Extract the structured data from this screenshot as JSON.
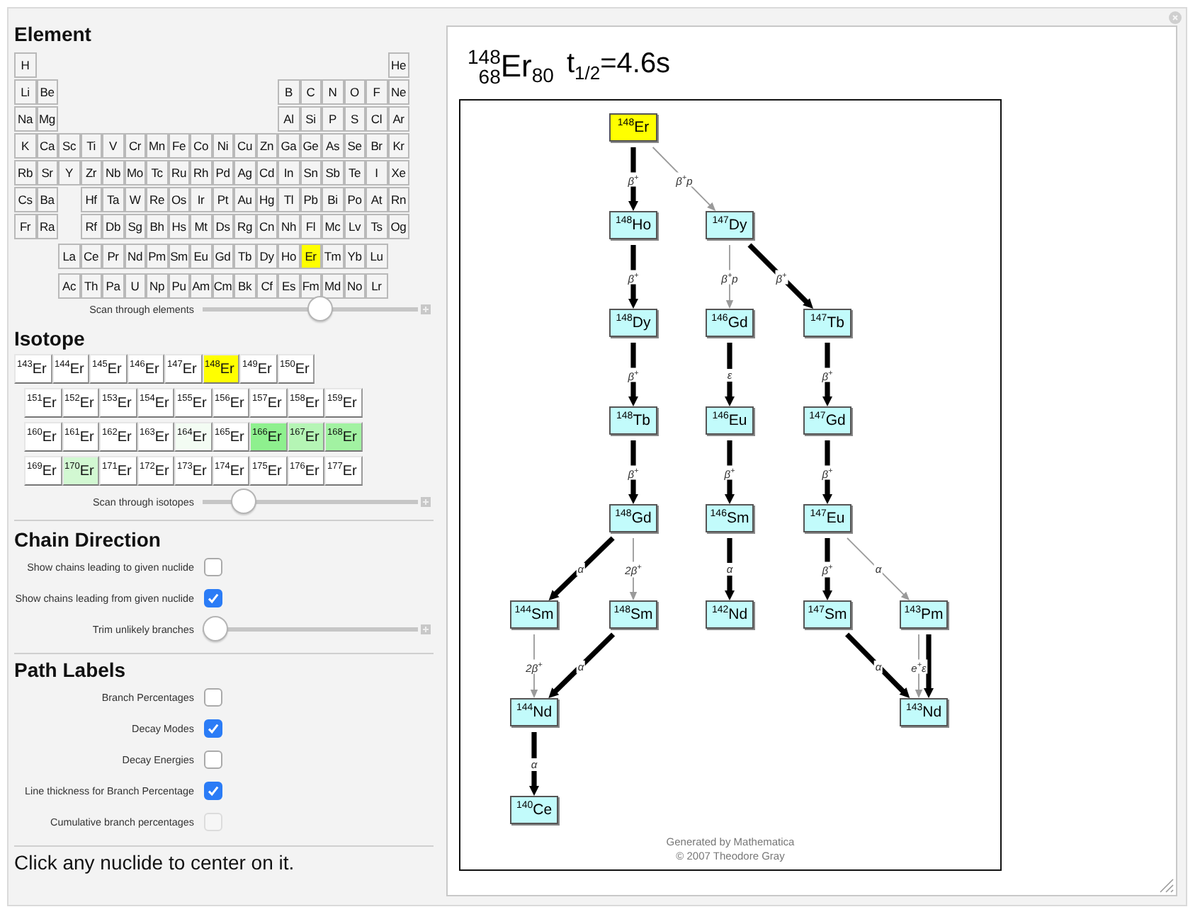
{
  "panel": {
    "element_section": {
      "heading": "Element",
      "table": [
        [
          [
            {
              "symbol": "H",
              "selected": false
            }
          ],
          [
            {
              "symbol": "He",
              "selected": false
            }
          ]
        ],
        [
          [
            {
              "symbol": "Li",
              "selected": false
            },
            {
              "symbol": "Be",
              "selected": false
            }
          ],
          [
            {
              "symbol": "B",
              "selected": false
            },
            {
              "symbol": "C",
              "selected": false
            },
            {
              "symbol": "N",
              "selected": false
            },
            {
              "symbol": "O",
              "selected": false
            },
            {
              "symbol": "F",
              "selected": false
            },
            {
              "symbol": "Ne",
              "selected": false
            }
          ]
        ],
        [
          [
            {
              "symbol": "Na",
              "selected": false
            },
            {
              "symbol": "Mg",
              "selected": false
            }
          ],
          [
            {
              "symbol": "Al",
              "selected": false
            },
            {
              "symbol": "Si",
              "selected": false
            },
            {
              "symbol": "P",
              "selected": false
            },
            {
              "symbol": "S",
              "selected": false
            },
            {
              "symbol": "Cl",
              "selected": false
            },
            {
              "symbol": "Ar",
              "selected": false
            }
          ]
        ],
        [
          [
            {
              "symbol": "K",
              "selected": false
            },
            {
              "symbol": "Ca",
              "selected": false
            },
            {
              "symbol": "Sc",
              "selected": false
            },
            {
              "symbol": "Ti",
              "selected": false
            },
            {
              "symbol": "V",
              "selected": false
            },
            {
              "symbol": "Cr",
              "selected": false
            },
            {
              "symbol": "Mn",
              "selected": false
            },
            {
              "symbol": "Fe",
              "selected": false
            },
            {
              "symbol": "Co",
              "selected": false
            },
            {
              "symbol": "Ni",
              "selected": false
            },
            {
              "symbol": "Cu",
              "selected": false
            },
            {
              "symbol": "Zn",
              "selected": false
            },
            {
              "symbol": "Ga",
              "selected": false
            },
            {
              "symbol": "Ge",
              "selected": false
            },
            {
              "symbol": "As",
              "selected": false
            },
            {
              "symbol": "Se",
              "selected": false
            },
            {
              "symbol": "Br",
              "selected": false
            },
            {
              "symbol": "Kr",
              "selected": false
            }
          ]
        ],
        [
          [
            {
              "symbol": "Rb",
              "selected": false
            },
            {
              "symbol": "Sr",
              "selected": false
            },
            {
              "symbol": "Y",
              "selected": false
            },
            {
              "symbol": "Zr",
              "selected": false
            },
            {
              "symbol": "Nb",
              "selected": false
            },
            {
              "symbol": "Mo",
              "selected": false
            },
            {
              "symbol": "Tc",
              "selected": false
            },
            {
              "symbol": "Ru",
              "selected": false
            },
            {
              "symbol": "Rh",
              "selected": false
            },
            {
              "symbol": "Pd",
              "selected": false
            },
            {
              "symbol": "Ag",
              "selected": false
            },
            {
              "symbol": "Cd",
              "selected": false
            },
            {
              "symbol": "In",
              "selected": false
            },
            {
              "symbol": "Sn",
              "selected": false
            },
            {
              "symbol": "Sb",
              "selected": false
            },
            {
              "symbol": "Te",
              "selected": false
            },
            {
              "symbol": "I",
              "selected": false
            },
            {
              "symbol": "Xe",
              "selected": false
            }
          ]
        ],
        [
          [
            {
              "symbol": "Cs",
              "selected": false
            },
            {
              "symbol": "Ba",
              "selected": false
            }
          ],
          [
            {
              "symbol": "Hf",
              "selected": false
            },
            {
              "symbol": "Ta",
              "selected": false
            },
            {
              "symbol": "W",
              "selected": false
            },
            {
              "symbol": "Re",
              "selected": false
            },
            {
              "symbol": "Os",
              "selected": false
            },
            {
              "symbol": "Ir",
              "selected": false
            },
            {
              "symbol": "Pt",
              "selected": false
            },
            {
              "symbol": "Au",
              "selected": false
            },
            {
              "symbol": "Hg",
              "selected": false
            },
            {
              "symbol": "Tl",
              "selected": false
            },
            {
              "symbol": "Pb",
              "selected": false
            },
            {
              "symbol": "Bi",
              "selected": false
            },
            {
              "symbol": "Po",
              "selected": false
            },
            {
              "symbol": "At",
              "selected": false
            },
            {
              "symbol": "Rn",
              "selected": false
            }
          ]
        ],
        [
          [
            {
              "symbol": "Fr",
              "selected": false
            },
            {
              "symbol": "Ra",
              "selected": false
            }
          ],
          [
            {
              "symbol": "Rf",
              "selected": false
            },
            {
              "symbol": "Db",
              "selected": false
            },
            {
              "symbol": "Sg",
              "selected": false
            },
            {
              "symbol": "Bh",
              "selected": false
            },
            {
              "symbol": "Hs",
              "selected": false
            },
            {
              "symbol": "Mt",
              "selected": false
            },
            {
              "symbol": "Ds",
              "selected": false
            },
            {
              "symbol": "Rg",
              "selected": false
            },
            {
              "symbol": "Cn",
              "selected": false
            },
            {
              "symbol": "Nh",
              "selected": false
            },
            {
              "symbol": "Fl",
              "selected": false
            },
            {
              "symbol": "Mc",
              "selected": false
            },
            {
              "symbol": "Lv",
              "selected": false
            },
            {
              "symbol": "Ts",
              "selected": false
            },
            {
              "symbol": "Og",
              "selected": false
            }
          ]
        ],
        [
          [
            {
              "symbol": "La",
              "selected": false
            },
            {
              "symbol": "Ce",
              "selected": false
            },
            {
              "symbol": "Pr",
              "selected": false
            },
            {
              "symbol": "Nd",
              "selected": false
            },
            {
              "symbol": "Pm",
              "selected": false
            },
            {
              "symbol": "Sm",
              "selected": false
            },
            {
              "symbol": "Eu",
              "selected": false
            },
            {
              "symbol": "Gd",
              "selected": false
            },
            {
              "symbol": "Tb",
              "selected": false
            },
            {
              "symbol": "Dy",
              "selected": false
            },
            {
              "symbol": "Ho",
              "selected": false
            },
            {
              "symbol": "Er",
              "selected": true
            },
            {
              "symbol": "Tm",
              "selected": false
            },
            {
              "symbol": "Yb",
              "selected": false
            },
            {
              "symbol": "Lu",
              "selected": false
            }
          ]
        ],
        [
          [
            {
              "symbol": "Ac",
              "selected": false
            },
            {
              "symbol": "Th",
              "selected": false
            },
            {
              "symbol": "Pa",
              "selected": false
            },
            {
              "symbol": "U",
              "selected": false
            },
            {
              "symbol": "Np",
              "selected": false
            },
            {
              "symbol": "Pu",
              "selected": false
            },
            {
              "symbol": "Am",
              "selected": false
            },
            {
              "symbol": "Cm",
              "selected": false
            },
            {
              "symbol": "Bk",
              "selected": false
            },
            {
              "symbol": "Cf",
              "selected": false
            },
            {
              "symbol": "Es",
              "selected": false
            },
            {
              "symbol": "Fm",
              "selected": false
            },
            {
              "symbol": "Md",
              "selected": false
            },
            {
              "symbol": "No",
              "selected": false
            },
            {
              "symbol": "Lr",
              "selected": false
            }
          ]
        ]
      ],
      "slider": {
        "label": "Scan through elements",
        "level": 0.55
      }
    },
    "isotope_section": {
      "heading": "Isotope",
      "rows": [
        [
          {
            "mass": "143",
            "symbol": "Er",
            "selected": false,
            "color": "#ffffff"
          },
          {
            "mass": "144",
            "symbol": "Er",
            "selected": false,
            "color": "#ffffff"
          },
          {
            "mass": "145",
            "symbol": "Er",
            "selected": false,
            "color": "#ffffff"
          },
          {
            "mass": "146",
            "symbol": "Er",
            "selected": false,
            "color": "#ffffff"
          },
          {
            "mass": "147",
            "symbol": "Er",
            "selected": false,
            "color": "#ffffff"
          },
          {
            "mass": "148",
            "symbol": "Er",
            "selected": true
          },
          {
            "mass": "149",
            "symbol": "Er",
            "selected": false,
            "color": "#ffffff"
          },
          {
            "mass": "150",
            "symbol": "Er",
            "selected": false,
            "color": "#ffffff"
          }
        ],
        [
          {
            "mass": "151",
            "symbol": "Er",
            "selected": false,
            "color": "#ffffff"
          },
          {
            "mass": "152",
            "symbol": "Er",
            "selected": false,
            "color": "#ffffff"
          },
          {
            "mass": "153",
            "symbol": "Er",
            "selected": false,
            "color": "#ffffff"
          },
          {
            "mass": "154",
            "symbol": "Er",
            "selected": false,
            "color": "#ffffff"
          },
          {
            "mass": "155",
            "symbol": "Er",
            "selected": false,
            "color": "#ffffff"
          },
          {
            "mass": "156",
            "symbol": "Er",
            "selected": false,
            "color": "#ffffff"
          },
          {
            "mass": "157",
            "symbol": "Er",
            "selected": false,
            "color": "#ffffff"
          },
          {
            "mass": "158",
            "symbol": "Er",
            "selected": false,
            "color": "#ffffff"
          },
          {
            "mass": "159",
            "symbol": "Er",
            "selected": false,
            "color": "#ffffff"
          }
        ],
        [
          {
            "mass": "160",
            "symbol": "Er",
            "selected": false,
            "color": "#ffffff"
          },
          {
            "mass": "161",
            "symbol": "Er",
            "selected": false,
            "color": "#ffffff"
          },
          {
            "mass": "162",
            "symbol": "Er",
            "selected": false,
            "color": "#ffffff"
          },
          {
            "mass": "163",
            "symbol": "Er",
            "selected": false,
            "color": "#ffffff"
          },
          {
            "mass": "164",
            "symbol": "Er",
            "selected": false,
            "color": "#f3fcf3"
          },
          {
            "mass": "165",
            "symbol": "Er",
            "selected": false,
            "color": "#ffffff"
          },
          {
            "mass": "166",
            "symbol": "Er",
            "selected": false,
            "color": "#8ef08e"
          },
          {
            "mass": "167",
            "symbol": "Er",
            "selected": false,
            "color": "#b5f5b5"
          },
          {
            "mass": "168",
            "symbol": "Er",
            "selected": false,
            "color": "#a2f2a2"
          }
        ],
        [
          {
            "mass": "169",
            "symbol": "Er",
            "selected": false,
            "color": "#ffffff"
          },
          {
            "mass": "170",
            "symbol": "Er",
            "selected": false,
            "color": "#d2f8d2"
          },
          {
            "mass": "171",
            "symbol": "Er",
            "selected": false,
            "color": "#ffffff"
          },
          {
            "mass": "172",
            "symbol": "Er",
            "selected": false,
            "color": "#ffffff"
          },
          {
            "mass": "173",
            "symbol": "Er",
            "selected": false,
            "color": "#ffffff"
          },
          {
            "mass": "174",
            "symbol": "Er",
            "selected": false,
            "color": "#ffffff"
          },
          {
            "mass": "175",
            "symbol": "Er",
            "selected": false,
            "color": "#ffffff"
          },
          {
            "mass": "176",
            "symbol": "Er",
            "selected": false,
            "color": "#ffffff"
          },
          {
            "mass": "177",
            "symbol": "Er",
            "selected": false,
            "color": "#ffffff"
          }
        ]
      ],
      "slider": {
        "label": "Scan through isotopes",
        "level": 0.15
      }
    },
    "chain_direction": {
      "heading": "Chain Direction",
      "controls": [
        {
          "kind": "checkbox",
          "label": "Show chains leading to given nuclide",
          "checked": false,
          "disabled": false
        },
        {
          "kind": "checkbox",
          "label": "Show chains leading from given nuclide",
          "checked": true,
          "disabled": false
        },
        {
          "kind": "slider",
          "label": "Trim unlikely branches",
          "level": 0
        }
      ]
    },
    "path_labels": {
      "heading": "Path Labels",
      "controls": [
        {
          "kind": "checkbox",
          "label": "Branch Percentages",
          "checked": false,
          "disabled": false
        },
        {
          "kind": "checkbox",
          "label": "Decay Modes",
          "checked": true,
          "disabled": false
        },
        {
          "kind": "checkbox",
          "label": "Decay Energies",
          "checked": false,
          "disabled": false
        },
        {
          "kind": "checkbox",
          "label": "Line thickness for Branch Percentage",
          "checked": true,
          "disabled": false
        },
        {
          "kind": "checkbox",
          "label": "Cumulative branch percentages",
          "checked": false,
          "disabled": true
        }
      ]
    },
    "hint": "Click any nuclide to center on it."
  },
  "output": {
    "title": {
      "mass": "148",
      "atomic_number": "68",
      "symbol": "Er",
      "neutron_number": "80",
      "half_life": "t$_{1/2}$=4.6s"
    },
    "diagram": {
      "nodes": [
        {
          "mass": "148",
          "symbol": "Er",
          "selected": true
        },
        {
          "mass": "148",
          "symbol": "Ho",
          "selected": false
        },
        {
          "mass": "147",
          "symbol": "Dy",
          "selected": false
        },
        {
          "mass": "148",
          "symbol": "Dy",
          "selected": false
        },
        {
          "mass": "146",
          "symbol": "Gd",
          "selected": false
        },
        {
          "mass": "147",
          "symbol": "Tb",
          "selected": false
        },
        {
          "mass": "148",
          "symbol": "Tb",
          "selected": false
        },
        {
          "mass": "146",
          "symbol": "Eu",
          "selected": false
        },
        {
          "mass": "147",
          "symbol": "Gd",
          "selected": false
        },
        {
          "mass": "148",
          "symbol": "Gd",
          "selected": false
        },
        {
          "mass": "146",
          "symbol": "Sm",
          "selected": false
        },
        {
          "mass": "147",
          "symbol": "Eu",
          "selected": false
        },
        {
          "mass": "144",
          "symbol": "Sm",
          "selected": false
        },
        {
          "mass": "148",
          "symbol": "Sm",
          "selected": false
        },
        {
          "mass": "142",
          "symbol": "Nd",
          "selected": false
        },
        {
          "mass": "147",
          "symbol": "Sm",
          "selected": false
        },
        {
          "mass": "143",
          "symbol": "Pm",
          "selected": false
        },
        {
          "mass": "144",
          "symbol": "Nd",
          "selected": false
        },
        {
          "mass": "143",
          "symbol": "Nd",
          "selected": false
        },
        {
          "mass": "140",
          "symbol": "Ce",
          "selected": false
        }
      ],
      "edges": [
        {
          "label": "β$^{+}$",
          "thick": true
        },
        {
          "label": "β$^{+}$p",
          "thick": false
        },
        {
          "label": "β$^{+}$",
          "thick": true
        },
        {
          "label": "β$^{+}$p",
          "thick": false
        },
        {
          "label": "β$^{+}$",
          "thick": true
        },
        {
          "label": "β$^{+}$",
          "thick": true
        },
        {
          "label": "ε",
          "thick": true
        },
        {
          "label": "β$^{+}$",
          "thick": true
        },
        {
          "label": "β$^{+}$",
          "thick": true
        },
        {
          "label": "β$^{+}$",
          "thick": true
        },
        {
          "label": "β$^{+}$",
          "thick": true
        },
        {
          "label": "α",
          "thick": true
        },
        {
          "label": "2β$^{+}$",
          "thick": false
        },
        {
          "label": "α",
          "thick": true
        },
        {
          "label": "β$^{+}$",
          "thick": true
        },
        {
          "label": "α",
          "thick": false
        },
        {
          "label": "2β$^{+}$",
          "thick": false
        },
        {
          "label": "α",
          "thick": true
        },
        {
          "label": "α",
          "thick": true
        },
        {
          "label": "e$^{+}$ε",
          "thick": false
        },
        {
          "thick": true
        },
        {
          "label": "α",
          "thick": true
        }
      ],
      "credits": [
        "Generated by Mathematica",
        "© 2007 Theodore Gray"
      ]
    }
  }
}
